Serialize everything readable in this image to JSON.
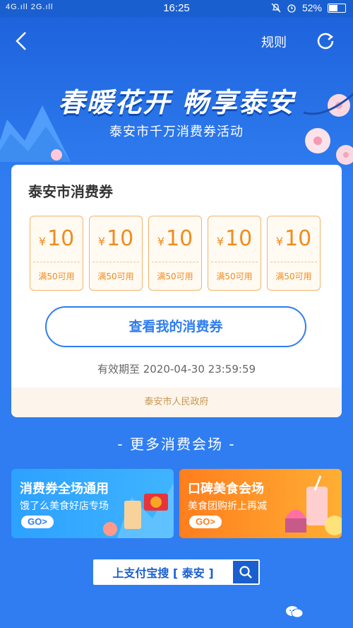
{
  "status": {
    "signal": "4G.ıll 2G.ıll",
    "time": "16:25",
    "battery": "52%",
    "battery_level": 0.52
  },
  "header": {
    "rule_label": "规则"
  },
  "hero": {
    "title": "春暖花开 畅享泰安",
    "subtitle": "泰安市千万消费券活动"
  },
  "card": {
    "title": "泰安市消费券",
    "coupons": [
      {
        "currency": "¥",
        "amount": "10",
        "condition": "满50可用"
      },
      {
        "currency": "¥",
        "amount": "10",
        "condition": "满50可用"
      },
      {
        "currency": "¥",
        "amount": "10",
        "condition": "满50可用"
      },
      {
        "currency": "¥",
        "amount": "10",
        "condition": "满50可用"
      },
      {
        "currency": "¥",
        "amount": "10",
        "condition": "满50可用"
      }
    ],
    "view_button": "查看我的消费券",
    "validity": "有效期至 2020-04-30 23:59:59",
    "footer": "泰安市人民政府"
  },
  "more_title": "- 更多消费会场 -",
  "banners": [
    {
      "title": "消费券全场通用",
      "subtitle": "饿了么美食好店专场",
      "go": "GO>"
    },
    {
      "title": "口碑美食会场",
      "subtitle": "美食团购折上再减",
      "go": "GO>"
    }
  ],
  "search": {
    "text": "上支付宝搜 [ 泰安 ]"
  },
  "colors": {
    "primary": "#2f7df0",
    "coupon_orange": "#f08c1e"
  }
}
